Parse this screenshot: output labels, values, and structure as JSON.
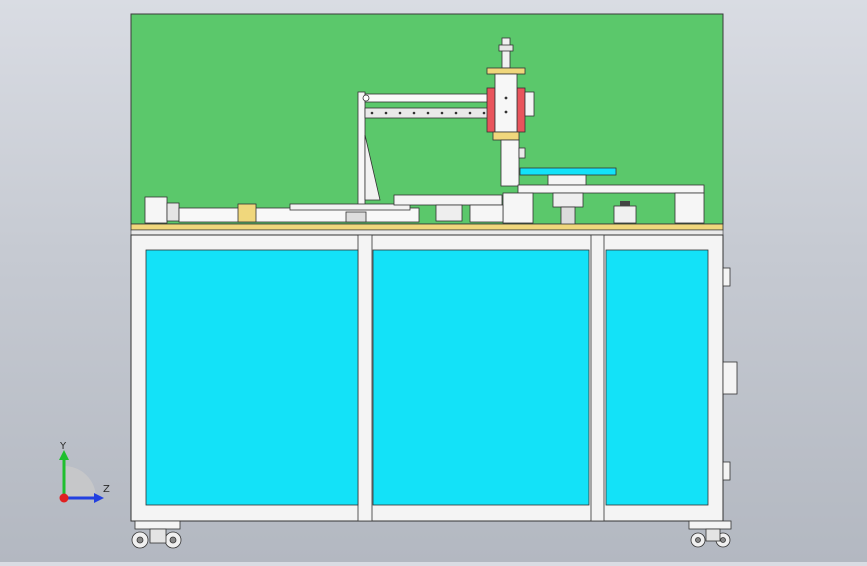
{
  "viewport": {
    "background_top": "#d9dce3",
    "background_bottom": "#b3b8c1"
  },
  "model": {
    "top_panel_color": "#5bc86b",
    "glass_panel_color": "#13e2f8",
    "deck_plate_color": "#f0d77c",
    "frame_color": "#f4f4f4",
    "motor_accent_color": "#e9545c",
    "panel_count": 3,
    "caster_count": 2,
    "side_handle_count": 3
  },
  "triad": {
    "y_label": "Y",
    "z_label": "Z",
    "y_color": "#1fbf2e",
    "z_color": "#2340e0",
    "x_color": "#e02020"
  }
}
